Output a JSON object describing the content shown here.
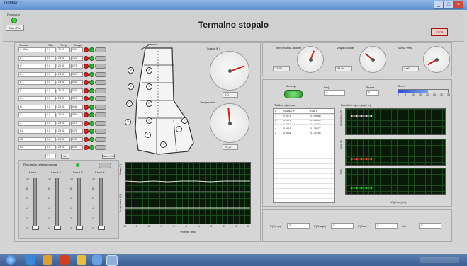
{
  "window": {
    "title": "Untitled 1"
  },
  "header": {
    "title": "Termalno stopalo",
    "left_label": "Povezano",
    "connect_button": "Conn Port",
    "stop_button": "STOP"
  },
  "sensor_table": {
    "columns": [
      "Senzor",
      "Sila",
      "Temp",
      "Snaga"
    ],
    "rows": [
      {
        "name": "A - Peta",
        "v1": "0.0",
        "v2": "25.60",
        "v3": "0.00"
      },
      {
        "name": "B",
        "v1": "0.0",
        "v2": "25.50",
        "v3": "1.20"
      },
      {
        "name": "C",
        "v1": "0.0",
        "v2": "26.00",
        "v3": "0.75"
      },
      {
        "name": "D",
        "v1": "0.0",
        "v2": "25.80",
        "v3": "0.60"
      },
      {
        "name": "E",
        "v1": "0.0",
        "v2": "25.90",
        "v3": "0.30"
      },
      {
        "name": "F",
        "v1": "0.0",
        "v2": "25.50",
        "v3": "0.30"
      },
      {
        "name": "G",
        "v1": "0.0",
        "v2": "26.00",
        "v3": "0.70"
      },
      {
        "name": "H",
        "v1": "0.0",
        "v2": "26.00",
        "v3": "0.45"
      },
      {
        "name": "I",
        "v1": "0.0",
        "v2": "24.00",
        "v3": "0.50"
      },
      {
        "name": "J",
        "v1": "0.0",
        "v2": "26.00",
        "v3": "1.10"
      },
      {
        "name": "K1",
        "v1": "0.0",
        "v2": "25.50",
        "v3": "0.75"
      },
      {
        "name": "K2",
        "v1": "0.0",
        "v2": "25.80",
        "v3": "0.40"
      },
      {
        "name": "L1",
        "v1": "0.0",
        "v2": "26.00",
        "v3": "0.30"
      }
    ],
    "footer_value": "0.0",
    "add_button": "Set",
    "save_button": "Save 0%"
  },
  "regulation": {
    "title": "Regulacija snijenja motora",
    "sliders": [
      {
        "label": "Kanal 1",
        "level": 0
      },
      {
        "label": "Kanal 2",
        "level": 0
      },
      {
        "label": "Kanal 3",
        "level": 0
      },
      {
        "label": "Kanal 4",
        "level": 0
      }
    ],
    "ticks": [
      "10",
      "8",
      "6",
      "4",
      "2",
      "0"
    ]
  },
  "boot_labels": [
    "A",
    "B",
    "C",
    "D",
    "E",
    "F",
    "G",
    "H",
    "I",
    "J",
    "K",
    "L"
  ],
  "gauges": {
    "force": {
      "label": "Snaga (F)",
      "value": "0.0"
    },
    "temperature": {
      "label": "Temperatura",
      "value": "25.27"
    }
  },
  "left_chart": {
    "y1": "Snaga (F)",
    "y2": "Temperatura (°C)",
    "xlabel": "Vrijeme (ms)",
    "xticks": [
      "-10",
      "-9",
      "-8",
      "-7",
      "-6",
      "-5",
      "-4",
      "-3",
      "-2",
      "-1",
      "0"
    ]
  },
  "env": {
    "t_label": "Temperatura okoline",
    "t_value": "21.97",
    "h_label": "Vlaga okoline",
    "h_value": "54 %",
    "w_label": "Brzina vetra",
    "w_value": "0.00"
  },
  "measure": {
    "button": "Mjerenje",
    "rbf_label": "Broj",
    "rbf_value": "0",
    "speed_label": "Brzina",
    "speed_value": "0",
    "timer_label": "Timer",
    "timer_ticks": [
      "0",
      "5",
      "10",
      "15",
      "20",
      "25",
      "30",
      "35"
    ],
    "table_title": "Tablica mjerenja",
    "table_columns": [
      "#",
      "Snaga (F)",
      "Raz.k"
    ],
    "table_rows": [
      {
        "n": "1",
        "a": "0.9971",
        "b": "0.199888"
      },
      {
        "n": "2",
        "a": "0.9971",
        "b": "0.149895"
      },
      {
        "n": "3",
        "a": "0.9919",
        "b": "0.149895"
      },
      {
        "n": "4",
        "a": "0.9919",
        "b": "0.139977"
      },
      {
        "n": "5",
        "a": "0.9948",
        "b": "0.139785"
      }
    ]
  },
  "right_charts": {
    "title": "Rezultati mjerenja (0 s.)",
    "labels": [
      "Temperatura (°C)",
      "Snaga (F)",
      "Timer"
    ],
    "xlabel": "Vrijeme (ms)",
    "colors": [
      "#e0e0e0",
      "#e05a2a",
      "#2ec82e"
    ]
  },
  "bottom_fields": [
    {
      "label": "P(Temp)",
      "value": "0"
    },
    {
      "label": "P(Snaga)",
      "value": "0"
    },
    {
      "label": "P(Rcn)",
      "value": "0"
    },
    {
      "label": "Cm",
      "value": "0"
    }
  ]
}
